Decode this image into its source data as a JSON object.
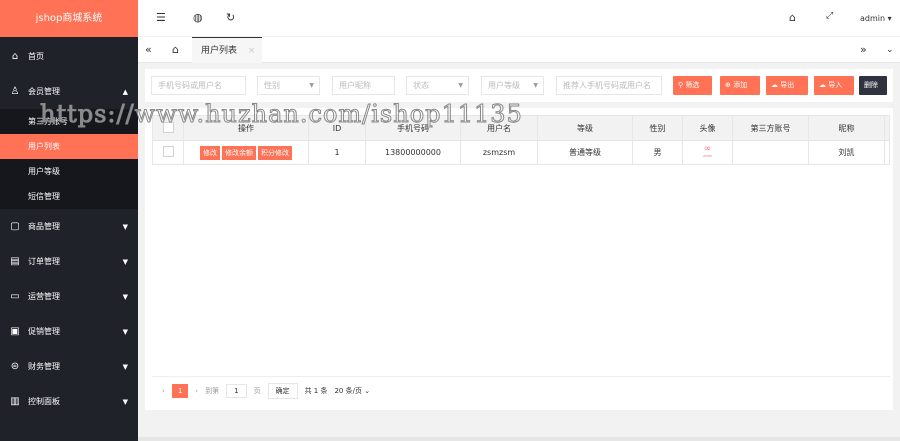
{
  "sidebar": {
    "logo": "jshop商城系统",
    "items": [
      {
        "label": "首页",
        "icon": "home-icon"
      },
      {
        "label": "会员管理",
        "icon": "user-icon",
        "sub": [
          "第三方账号",
          "用户列表",
          "用户等级",
          "短信管理"
        ]
      },
      {
        "label": "商品管理",
        "icon": "goods-icon"
      },
      {
        "label": "订单管理",
        "icon": "order-icon"
      },
      {
        "label": "运营管理",
        "icon": "operation-icon"
      },
      {
        "label": "促销管理",
        "icon": "promotion-icon"
      },
      {
        "label": "财务管理",
        "icon": "finance-icon"
      },
      {
        "label": "控制面板",
        "icon": "control-panel-icon"
      }
    ]
  },
  "topbar": {
    "user": "admin"
  },
  "tabs": {
    "active": "用户列表"
  },
  "filter": {
    "mobile_placeholder": "手机号码或用户名",
    "gender": "性别",
    "nickname_placeholder": "用户昵称",
    "status": "状态",
    "grade": "用户等级",
    "referrer_placeholder": "推荐人手机号码或用户名",
    "search": "筛选",
    "add": "添加",
    "export": "导出",
    "import": "导入",
    "delete": "删除"
  },
  "table": {
    "headers": [
      "操作",
      "ID",
      "手机号码",
      "用户名",
      "等级",
      "性别",
      "头像",
      "第三方账号",
      "昵称"
    ],
    "actions": [
      "修改",
      "修改余额",
      "积分修改"
    ],
    "rows": [
      {
        "id": "1",
        "mobile": "13800000000",
        "username": "zsmzsm",
        "grade": "普通等级",
        "gender": "男",
        "avatar": "JSHOP",
        "third": "",
        "nickname": "刘凯"
      }
    ]
  },
  "pager": {
    "current": "1",
    "goto": "到第",
    "page_input": "1",
    "page_unit": "页",
    "confirm": "确定",
    "total": "共 1 条",
    "per_page": "20 条/页"
  },
  "watermark": "https://www.huzhan.com/ishop11135",
  "colors": {
    "accent": "#ff7256",
    "sidebar": "#20222a"
  }
}
